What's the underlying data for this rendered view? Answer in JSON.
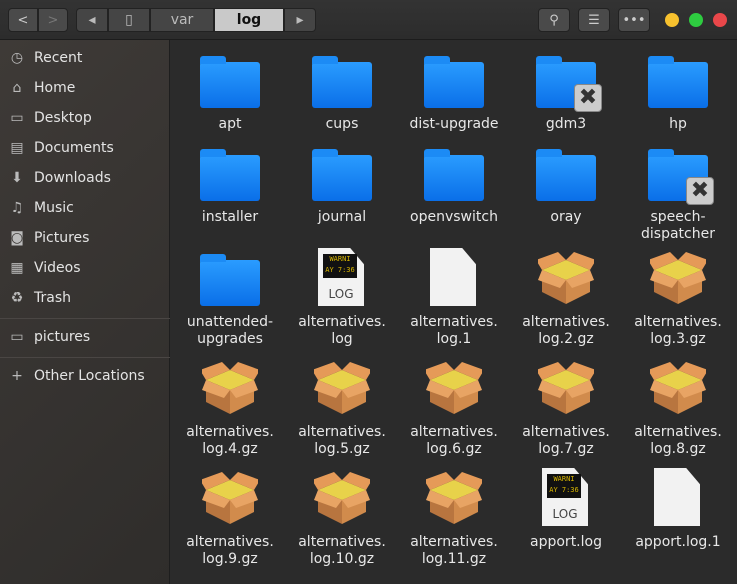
{
  "header": {
    "breadcrumbs": [
      "var",
      "log"
    ],
    "active": "log"
  },
  "sidebar": {
    "items": [
      {
        "label": "Recent",
        "icon": "clock-icon",
        "glyph": "◷"
      },
      {
        "label": "Home",
        "icon": "home-icon",
        "glyph": "⌂"
      },
      {
        "label": "Desktop",
        "icon": "desktop-icon",
        "glyph": "▭"
      },
      {
        "label": "Documents",
        "icon": "documents-icon",
        "glyph": "▤"
      },
      {
        "label": "Downloads",
        "icon": "download-icon",
        "glyph": "⬇"
      },
      {
        "label": "Music",
        "icon": "music-icon",
        "glyph": "♫"
      },
      {
        "label": "Pictures",
        "icon": "camera-icon",
        "glyph": "◙"
      },
      {
        "label": "Videos",
        "icon": "film-icon",
        "glyph": "▦"
      },
      {
        "label": "Trash",
        "icon": "trash-icon",
        "glyph": "♻"
      }
    ],
    "bookmarks": [
      {
        "label": "pictures",
        "icon": "folder-icon",
        "glyph": "▭"
      }
    ],
    "other": {
      "label": "Other Locations",
      "glyph": "+"
    }
  },
  "files": [
    {
      "name": "apt",
      "type": "folder"
    },
    {
      "name": "cups",
      "type": "folder"
    },
    {
      "name": "dist-upgrade",
      "type": "folder"
    },
    {
      "name": "gdm3",
      "type": "folder-locked"
    },
    {
      "name": "hp",
      "type": "folder"
    },
    {
      "name": "installer",
      "type": "folder"
    },
    {
      "name": "journal",
      "type": "folder"
    },
    {
      "name": "openvswitch",
      "type": "folder"
    },
    {
      "name": "oray",
      "type": "folder"
    },
    {
      "name": "speech-dispatcher",
      "type": "folder-locked"
    },
    {
      "name": "unattended-upgrades",
      "type": "folder"
    },
    {
      "name": "alternatives.log",
      "type": "log"
    },
    {
      "name": "alternatives.log.1",
      "type": "text"
    },
    {
      "name": "alternatives.log.2.gz",
      "type": "archive"
    },
    {
      "name": "alternatives.log.3.gz",
      "type": "archive"
    },
    {
      "name": "alternatives.log.4.gz",
      "type": "archive"
    },
    {
      "name": "alternatives.log.5.gz",
      "type": "archive"
    },
    {
      "name": "alternatives.log.6.gz",
      "type": "archive"
    },
    {
      "name": "alternatives.log.7.gz",
      "type": "archive"
    },
    {
      "name": "alternatives.log.8.gz",
      "type": "archive"
    },
    {
      "name": "alternatives.log.9.gz",
      "type": "archive"
    },
    {
      "name": "alternatives.log.10.gz",
      "type": "archive"
    },
    {
      "name": "alternatives.log.11.gz",
      "type": "archive"
    },
    {
      "name": "apport.log",
      "type": "log"
    },
    {
      "name": "apport.log.1",
      "type": "text"
    }
  ],
  "log_icon": {
    "screen_line1": "WARNI",
    "screen_line2": "AY 7:36",
    "label": "LOG"
  },
  "colors": {
    "folder": "#1a8cf7",
    "close": "#e9474a",
    "maximize": "#2ecc40",
    "minimize": "#f7c12e"
  }
}
